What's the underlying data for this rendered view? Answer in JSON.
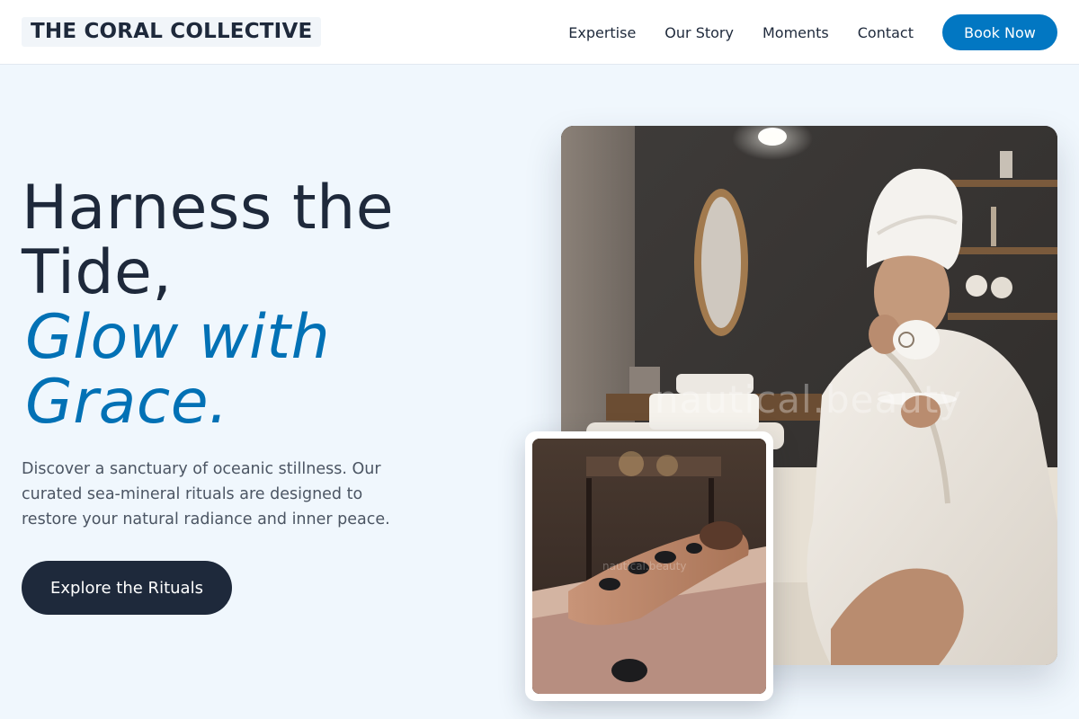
{
  "brand": {
    "name": "THE CORAL COLLECTIVE"
  },
  "nav": {
    "links": [
      "Expertise",
      "Our Story",
      "Moments",
      "Contact"
    ],
    "book_label": "Book Now"
  },
  "hero": {
    "title_line1": "Harness the",
    "title_line2": "Tide,",
    "accent_line1": "Glow with",
    "accent_line2": "Grace.",
    "description": "Discover a sanctuary of oceanic stillness. Our curated sea-mineral rituals are designed to restore your natural radiance and inner peace.",
    "cta_label": "Explore the Rituals"
  },
  "images": {
    "main_watermark": "nautical.beauty",
    "inset_watermark": "nautical.beauty"
  },
  "colors": {
    "accent": "#0277c2",
    "dark": "#1e293b",
    "background": "#f0f7fd"
  }
}
